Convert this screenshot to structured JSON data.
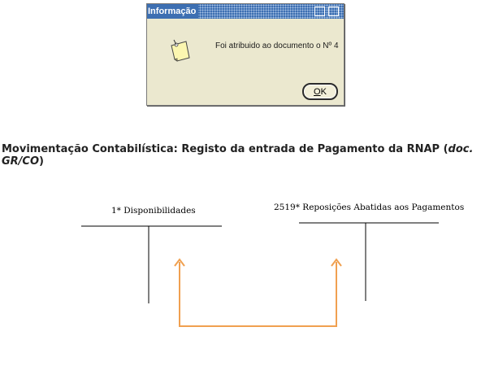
{
  "dialog": {
    "title": "Informação",
    "message": "Foi atribuido ao documento o Nº 4",
    "ok_button_rest": "K",
    "ok_button_mnemonic": "O",
    "icon": "note-icon"
  },
  "heading": {
    "text": "Movimentação Contabilística: Registo da entrada de Pagamento da RNAP (",
    "doc_ref": "doc. GR/CO",
    "close": ")"
  },
  "accounts": [
    {
      "label": "1* Disponibilidades"
    },
    {
      "label": "2519* Reposições Abatidas aos Pagamentos"
    }
  ],
  "colors": {
    "arrow": "#f0a050",
    "titlebar": "#3d6fb2",
    "dialog_bg": "#ebe8cf"
  }
}
